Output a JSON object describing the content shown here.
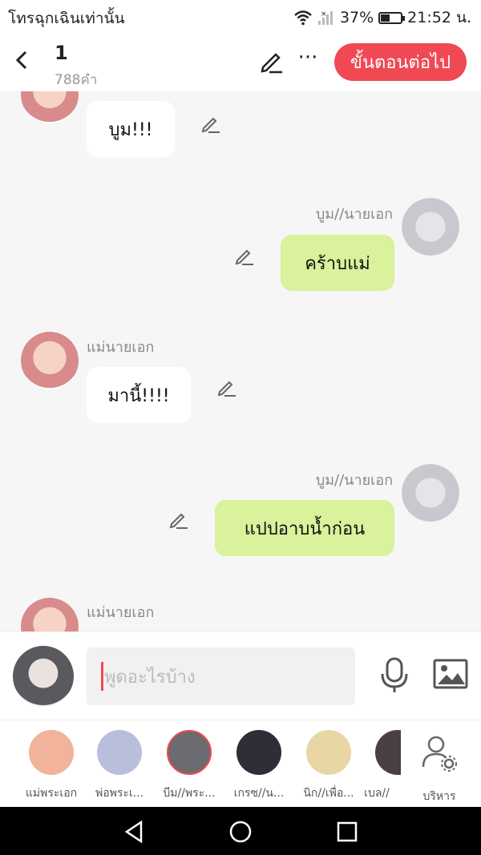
{
  "status": {
    "carrier": "โทรฉุกเฉินเท่านั้น",
    "battery": "37%",
    "time": "21:52 น."
  },
  "header": {
    "back_icon": "chevron-left-icon",
    "title": "1",
    "subtitle": "788คำ",
    "edit_icon": "pencil-icon",
    "more_label": "···",
    "next_label": "ขั้นตอนต่อไป"
  },
  "messages": [
    {
      "speaker": "",
      "text": "บูม!!!",
      "side": "left"
    },
    {
      "speaker": "บูม//นายเอก",
      "text": "คร้าบแม่",
      "side": "right"
    },
    {
      "speaker": "แม่นายเอก",
      "text": "มานี้!!!!",
      "side": "left"
    },
    {
      "speaker": "บูม//นายเอก",
      "text": "แปปอาบน้ำก่อน",
      "side": "right"
    },
    {
      "speaker": "แม่นายเอก",
      "text": "",
      "side": "left"
    }
  ],
  "composer": {
    "placeholder": "พูดอะไรบ้าง",
    "mic_icon": "microphone-icon",
    "image_icon": "image-icon"
  },
  "characters": [
    {
      "label": "แม่พระเอก",
      "color": "#f1b39a"
    },
    {
      "label": "พ่อพระเ...",
      "color": "#b9bedb"
    },
    {
      "label": "บีม//พระ...",
      "color": "#6b6b70"
    },
    {
      "label": "เกรซ//น...",
      "color": "#2e2e38"
    },
    {
      "label": "นิก//เพื่อ...",
      "color": "#e8d6a4"
    },
    {
      "label": "เบล//",
      "color": "#4a3f45"
    }
  ],
  "manage": {
    "label": "บริหาร",
    "icon": "manage-users-icon"
  },
  "navbar": {
    "back_icon": "triangle-back-icon",
    "home_icon": "circle-home-icon",
    "recent_icon": "square-recent-icon"
  },
  "colors": {
    "accent": "#f04954",
    "bubble_green": "#d9f29b"
  }
}
